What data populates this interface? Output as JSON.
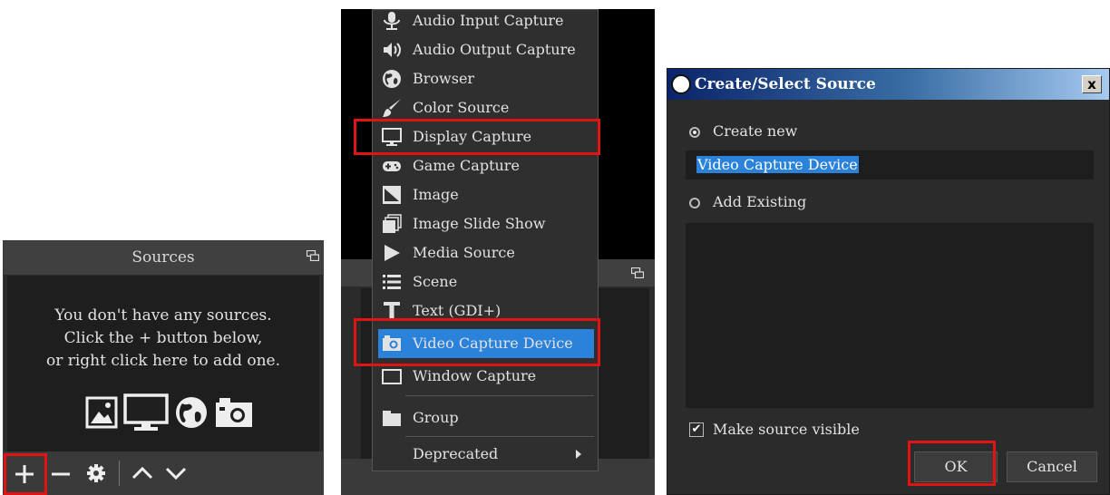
{
  "sources_dock": {
    "title": "Sources",
    "empty_lines": [
      "You don't have any sources.",
      "Click the + button below,",
      "or right click here to add one."
    ],
    "toolbar_icons": [
      "plus-icon",
      "minus-icon",
      "gear-icon",
      "chevron-up-icon",
      "chevron-down-icon"
    ]
  },
  "add_menu": {
    "items": [
      {
        "label": "Audio Input Capture",
        "icon": "microphone-icon"
      },
      {
        "label": "Audio Output Capture",
        "icon": "speaker-icon"
      },
      {
        "label": "Browser",
        "icon": "globe-icon"
      },
      {
        "label": "Color Source",
        "icon": "paintbrush-icon"
      },
      {
        "label": "Display Capture",
        "icon": "monitor-icon"
      },
      {
        "label": "Game Capture",
        "icon": "gamepad-icon"
      },
      {
        "label": "Image",
        "icon": "image-icon"
      },
      {
        "label": "Image Slide Show",
        "icon": "slideshow-icon"
      },
      {
        "label": "Media Source",
        "icon": "play-icon"
      },
      {
        "label": "Scene",
        "icon": "list-icon"
      },
      {
        "label": "Text (GDI+)",
        "icon": "text-icon"
      },
      {
        "label": "Video Capture Device",
        "icon": "camera-icon"
      },
      {
        "label": "Window Capture",
        "icon": "window-icon"
      },
      {
        "label": "Group",
        "icon": "folder-icon"
      },
      {
        "label": "Deprecated",
        "icon": ""
      }
    ],
    "selected": "Video Capture Device",
    "highlighted": [
      "Display Capture",
      "Video Capture Device"
    ]
  },
  "dialog": {
    "title": "Create/Select Source",
    "close_label": "x",
    "create_new_label": "Create new",
    "name_value": "Video Capture Device",
    "add_existing_label": "Add Existing",
    "make_visible_label": "Make source visible",
    "make_visible_checked": true,
    "ok_label": "OK",
    "cancel_label": "Cancel"
  },
  "colors": {
    "highlight": "#e11414",
    "selection": "#2a82da",
    "dock_bg": "#2b2b2b",
    "list_bg": "#1e1e1e"
  }
}
